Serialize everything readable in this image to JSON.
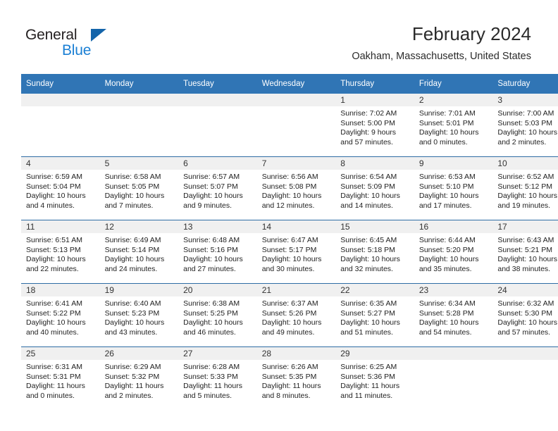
{
  "brand": {
    "name_top": "General",
    "name_bottom": "Blue",
    "accent_color": "#1a7fd4",
    "triangle_color": "#1464aa"
  },
  "header": {
    "title": "February 2024",
    "location": "Oakham, Massachusetts, United States"
  },
  "theme": {
    "header_row_bg": "#3075b5",
    "daynum_band_bg": "#f0f0f0",
    "row_divider": "#2e6da4"
  },
  "weekdays": [
    "Sunday",
    "Monday",
    "Tuesday",
    "Wednesday",
    "Thursday",
    "Friday",
    "Saturday"
  ],
  "labels": {
    "sunrise_prefix": "Sunrise:",
    "sunset_prefix": "Sunset:",
    "daylight_prefix": "Daylight:"
  },
  "weeks": [
    [
      {
        "day": ""
      },
      {
        "day": ""
      },
      {
        "day": ""
      },
      {
        "day": ""
      },
      {
        "day": "1",
        "sunrise": "Sunrise: 7:02 AM",
        "sunset": "Sunset: 5:00 PM",
        "daylight_1": "Daylight: 9 hours",
        "daylight_2": "and 57 minutes."
      },
      {
        "day": "2",
        "sunrise": "Sunrise: 7:01 AM",
        "sunset": "Sunset: 5:01 PM",
        "daylight_1": "Daylight: 10 hours",
        "daylight_2": "and 0 minutes."
      },
      {
        "day": "3",
        "sunrise": "Sunrise: 7:00 AM",
        "sunset": "Sunset: 5:03 PM",
        "daylight_1": "Daylight: 10 hours",
        "daylight_2": "and 2 minutes."
      }
    ],
    [
      {
        "day": "4",
        "sunrise": "Sunrise: 6:59 AM",
        "sunset": "Sunset: 5:04 PM",
        "daylight_1": "Daylight: 10 hours",
        "daylight_2": "and 4 minutes."
      },
      {
        "day": "5",
        "sunrise": "Sunrise: 6:58 AM",
        "sunset": "Sunset: 5:05 PM",
        "daylight_1": "Daylight: 10 hours",
        "daylight_2": "and 7 minutes."
      },
      {
        "day": "6",
        "sunrise": "Sunrise: 6:57 AM",
        "sunset": "Sunset: 5:07 PM",
        "daylight_1": "Daylight: 10 hours",
        "daylight_2": "and 9 minutes."
      },
      {
        "day": "7",
        "sunrise": "Sunrise: 6:56 AM",
        "sunset": "Sunset: 5:08 PM",
        "daylight_1": "Daylight: 10 hours",
        "daylight_2": "and 12 minutes."
      },
      {
        "day": "8",
        "sunrise": "Sunrise: 6:54 AM",
        "sunset": "Sunset: 5:09 PM",
        "daylight_1": "Daylight: 10 hours",
        "daylight_2": "and 14 minutes."
      },
      {
        "day": "9",
        "sunrise": "Sunrise: 6:53 AM",
        "sunset": "Sunset: 5:10 PM",
        "daylight_1": "Daylight: 10 hours",
        "daylight_2": "and 17 minutes."
      },
      {
        "day": "10",
        "sunrise": "Sunrise: 6:52 AM",
        "sunset": "Sunset: 5:12 PM",
        "daylight_1": "Daylight: 10 hours",
        "daylight_2": "and 19 minutes."
      }
    ],
    [
      {
        "day": "11",
        "sunrise": "Sunrise: 6:51 AM",
        "sunset": "Sunset: 5:13 PM",
        "daylight_1": "Daylight: 10 hours",
        "daylight_2": "and 22 minutes."
      },
      {
        "day": "12",
        "sunrise": "Sunrise: 6:49 AM",
        "sunset": "Sunset: 5:14 PM",
        "daylight_1": "Daylight: 10 hours",
        "daylight_2": "and 24 minutes."
      },
      {
        "day": "13",
        "sunrise": "Sunrise: 6:48 AM",
        "sunset": "Sunset: 5:16 PM",
        "daylight_1": "Daylight: 10 hours",
        "daylight_2": "and 27 minutes."
      },
      {
        "day": "14",
        "sunrise": "Sunrise: 6:47 AM",
        "sunset": "Sunset: 5:17 PM",
        "daylight_1": "Daylight: 10 hours",
        "daylight_2": "and 30 minutes."
      },
      {
        "day": "15",
        "sunrise": "Sunrise: 6:45 AM",
        "sunset": "Sunset: 5:18 PM",
        "daylight_1": "Daylight: 10 hours",
        "daylight_2": "and 32 minutes."
      },
      {
        "day": "16",
        "sunrise": "Sunrise: 6:44 AM",
        "sunset": "Sunset: 5:20 PM",
        "daylight_1": "Daylight: 10 hours",
        "daylight_2": "and 35 minutes."
      },
      {
        "day": "17",
        "sunrise": "Sunrise: 6:43 AM",
        "sunset": "Sunset: 5:21 PM",
        "daylight_1": "Daylight: 10 hours",
        "daylight_2": "and 38 minutes."
      }
    ],
    [
      {
        "day": "18",
        "sunrise": "Sunrise: 6:41 AM",
        "sunset": "Sunset: 5:22 PM",
        "daylight_1": "Daylight: 10 hours",
        "daylight_2": "and 40 minutes."
      },
      {
        "day": "19",
        "sunrise": "Sunrise: 6:40 AM",
        "sunset": "Sunset: 5:23 PM",
        "daylight_1": "Daylight: 10 hours",
        "daylight_2": "and 43 minutes."
      },
      {
        "day": "20",
        "sunrise": "Sunrise: 6:38 AM",
        "sunset": "Sunset: 5:25 PM",
        "daylight_1": "Daylight: 10 hours",
        "daylight_2": "and 46 minutes."
      },
      {
        "day": "21",
        "sunrise": "Sunrise: 6:37 AM",
        "sunset": "Sunset: 5:26 PM",
        "daylight_1": "Daylight: 10 hours",
        "daylight_2": "and 49 minutes."
      },
      {
        "day": "22",
        "sunrise": "Sunrise: 6:35 AM",
        "sunset": "Sunset: 5:27 PM",
        "daylight_1": "Daylight: 10 hours",
        "daylight_2": "and 51 minutes."
      },
      {
        "day": "23",
        "sunrise": "Sunrise: 6:34 AM",
        "sunset": "Sunset: 5:28 PM",
        "daylight_1": "Daylight: 10 hours",
        "daylight_2": "and 54 minutes."
      },
      {
        "day": "24",
        "sunrise": "Sunrise: 6:32 AM",
        "sunset": "Sunset: 5:30 PM",
        "daylight_1": "Daylight: 10 hours",
        "daylight_2": "and 57 minutes."
      }
    ],
    [
      {
        "day": "25",
        "sunrise": "Sunrise: 6:31 AM",
        "sunset": "Sunset: 5:31 PM",
        "daylight_1": "Daylight: 11 hours",
        "daylight_2": "and 0 minutes."
      },
      {
        "day": "26",
        "sunrise": "Sunrise: 6:29 AM",
        "sunset": "Sunset: 5:32 PM",
        "daylight_1": "Daylight: 11 hours",
        "daylight_2": "and 2 minutes."
      },
      {
        "day": "27",
        "sunrise": "Sunrise: 6:28 AM",
        "sunset": "Sunset: 5:33 PM",
        "daylight_1": "Daylight: 11 hours",
        "daylight_2": "and 5 minutes."
      },
      {
        "day": "28",
        "sunrise": "Sunrise: 6:26 AM",
        "sunset": "Sunset: 5:35 PM",
        "daylight_1": "Daylight: 11 hours",
        "daylight_2": "and 8 minutes."
      },
      {
        "day": "29",
        "sunrise": "Sunrise: 6:25 AM",
        "sunset": "Sunset: 5:36 PM",
        "daylight_1": "Daylight: 11 hours",
        "daylight_2": "and 11 minutes."
      },
      {
        "day": ""
      },
      {
        "day": ""
      }
    ]
  ]
}
